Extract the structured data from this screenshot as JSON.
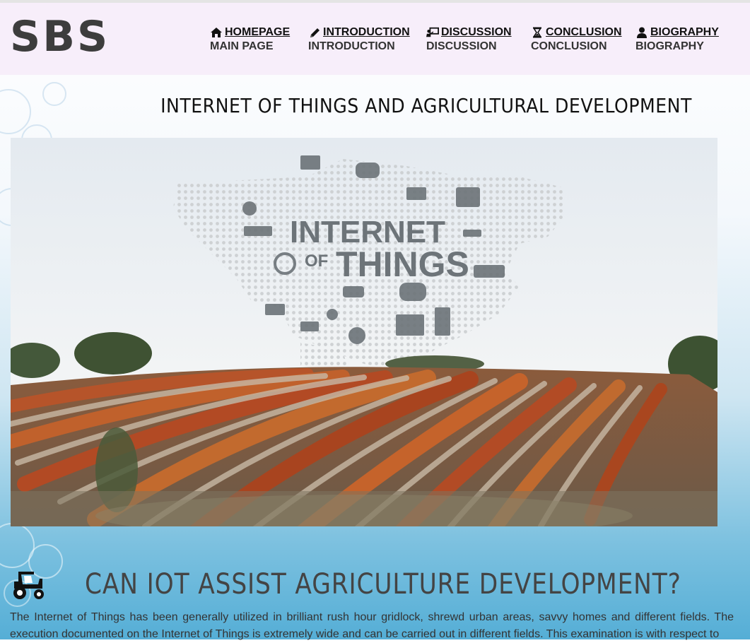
{
  "header": {
    "logo": "SBS",
    "nav": [
      {
        "label": "HOMEPAGE",
        "sub": "MAIN PAGE",
        "icon": "home-icon"
      },
      {
        "label": "INTRODUCTION",
        "sub": "INTRODUCTION",
        "icon": "pencil-icon"
      },
      {
        "label": "DISCUSSION",
        "sub": "DISCUSSION",
        "icon": "presentation-icon"
      },
      {
        "label": "CONCLUSION",
        "sub": "CONCLUSION",
        "icon": "hourglass-icon"
      },
      {
        "label": "BIOGRAPHY",
        "sub": "BIOGRAPHY",
        "icon": "user-icon"
      }
    ]
  },
  "main": {
    "title": "INTERNET OF THINGS AND AGRICULTURAL DEVELOPMENT",
    "hero": {
      "line1": "INTERNET",
      "of": "OF",
      "line2": "THINGS"
    },
    "section": {
      "icon": "tractor-icon",
      "heading": "CAN IOT ASSIST AGRICULTURE DEVELOPMENT?",
      "text": "The Internet of Things has been generally utilized in brilliant rush hour gridlock, shrewd urban areas, savvy homes and different fields. The execution documented on the Internet of Things is extremely wide and can be carried out in different fields. This examination is with respect to"
    }
  },
  "colors": {
    "header_bg": "#f7eefa",
    "logo": "#3d3d3d",
    "heading": "#444444"
  }
}
